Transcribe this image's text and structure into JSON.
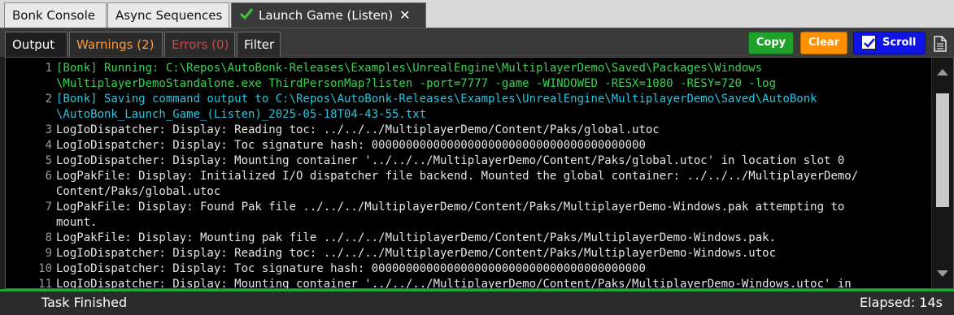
{
  "top_tabs": [
    {
      "label": "Bonk Console"
    },
    {
      "label": "Async Sequences"
    },
    {
      "label": "Launch Game (Listen)"
    }
  ],
  "sub_tabs": {
    "output": "Output",
    "warnings": "Warnings (2)",
    "errors": "Errors (0)",
    "filter": "Filter"
  },
  "buttons": {
    "copy": "Copy",
    "clear": "Clear",
    "scroll": "Scroll",
    "scroll_checked": true
  },
  "colors": {
    "copy": "#1fa12a",
    "clear": "#ff9000",
    "scroll": "#1014e6",
    "running_text": "#39d353",
    "saving_text": "#2ac4e0",
    "log_text": "#e6e6e6",
    "status_accent": "#1aa83c"
  },
  "icons": {
    "tab_status": "check-icon",
    "tab_close": "close-icon",
    "document": "document-icon"
  },
  "console_lines": [
    {
      "num": "1",
      "text": "[Bonk] Running: C:\\Repos\\AutoBonk-Releases\\Examples\\UnrealEngine\\MultiplayerDemo\\Saved\\Packages\\Windows",
      "color": "green"
    },
    {
      "num": "",
      "text": "\\MultiplayerDemoStandalone.exe ThirdPersonMap?listen -port=7777 -game -WINDOWED -RESX=1080 -RESY=720 -log",
      "color": "green"
    },
    {
      "num": "2",
      "text": "[Bonk] Saving command output to C:\\Repos\\AutoBonk-Releases\\Examples\\UnrealEngine\\MultiplayerDemo\\Saved\\AutoBonk",
      "color": "cyan"
    },
    {
      "num": "",
      "text": "\\AutoBonk_Launch_Game_(Listen)_2025-05-18T04-43-55.txt",
      "color": "cyan"
    },
    {
      "num": "3",
      "text": "LogIoDispatcher: Display: Reading toc: ../../../MultiplayerDemo/Content/Paks/global.utoc",
      "color": "white"
    },
    {
      "num": "4",
      "text": "LogIoDispatcher: Display: Toc signature hash: 0000000000000000000000000000000000000000",
      "color": "white"
    },
    {
      "num": "5",
      "text": "LogIoDispatcher: Display: Mounting container '../../../MultiplayerDemo/Content/Paks/global.utoc' in location slot 0",
      "color": "white"
    },
    {
      "num": "6",
      "text": "LogPakFile: Display: Initialized I/O dispatcher file backend. Mounted the global container: ../../../MultiplayerDemo/",
      "color": "white"
    },
    {
      "num": "",
      "text": "Content/Paks/global.utoc",
      "color": "white"
    },
    {
      "num": "7",
      "text": "LogPakFile: Display: Found Pak file ../../../MultiplayerDemo/Content/Paks/MultiplayerDemo-Windows.pak attempting to",
      "color": "white"
    },
    {
      "num": "",
      "text": "mount.",
      "color": "white"
    },
    {
      "num": "8",
      "text": "LogPakFile: Display: Mounting pak file ../../../MultiplayerDemo/Content/Paks/MultiplayerDemo-Windows.pak.",
      "color": "white"
    },
    {
      "num": "9",
      "text": "LogIoDispatcher: Display: Reading toc: ../../../MultiplayerDemo/Content/Paks/MultiplayerDemo-Windows.utoc",
      "color": "white"
    },
    {
      "num": "10",
      "text": "LogIoDispatcher: Display: Toc signature hash: 0000000000000000000000000000000000000000",
      "color": "white"
    },
    {
      "num": "11",
      "text": "LogIoDispatcher: Display: Mounting container '../../../MultiplayerDemo/Content/Paks/MultiplayerDemo-Windows.utoc' in",
      "color": "white"
    }
  ],
  "status": {
    "left": "Task Finished",
    "right": "Elapsed: 14s"
  }
}
